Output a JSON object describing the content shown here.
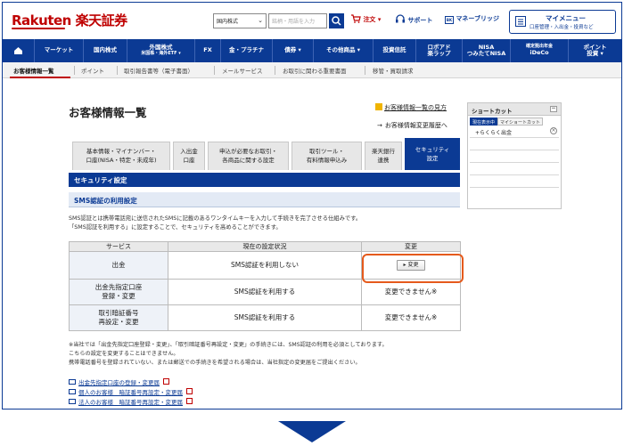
{
  "header": {
    "logo": "Rakuten 楽天証券",
    "select_value": "国内株式",
    "search_placeholder": "銘柄・用語を入力",
    "order_label": "注文",
    "support_label": "サポート",
    "money_bridge_label": "マネーブリッジ",
    "menu_label": "マイメニュー",
    "menu_sub": "口座管理・入出金・投資など"
  },
  "nav": {
    "items": [
      {
        "label": "マーケット"
      },
      {
        "label": "国内株式"
      },
      {
        "label": "外国株式",
        "sub": "米国株・海外ETF ▾"
      },
      {
        "label": "FX"
      },
      {
        "label": "金・プラチナ"
      },
      {
        "label": "債券 ▾"
      },
      {
        "label": "その他商品 ▾"
      },
      {
        "label": "投資信託"
      },
      {
        "label": "ロボアド",
        "sub": "楽ラップ"
      },
      {
        "label": "NISA",
        "sub": "つみたてNISA"
      },
      {
        "label": "確定拠出年金",
        "sub": "iDeCo"
      },
      {
        "label": "ポイント",
        "sub": "投資 ▾"
      }
    ]
  },
  "subnav": {
    "items": [
      "お客様情報一覧",
      "ポイント",
      "取引報告書等（電子書面）",
      "メールサービス",
      "お取引に関わる重要書面",
      "移管・買取請求"
    ]
  },
  "page": {
    "title": "お客様情報一覧",
    "guide_link": "お客様情報一覧の見方",
    "history_link": "お客様情報変更履歴へ"
  },
  "tabs": [
    "基本情報・マイナンバー・\n口座(NISA・特定・未成年)",
    "入出金\n口座",
    "申込が必要なお取引・\n各商品に関する設定",
    "取引ツール・\n有料情報申込み",
    "楽天銀行\n連携",
    "セキュリティ\n設定"
  ],
  "section": {
    "bar": "セキュリティ設定",
    "sub_bar": "SMS認証の利用設定",
    "desc_line1": "SMS認証とは携帯電話宛に送信されたSMSに記載のあるワンタイムキーを入力して手続きを完了させる仕組みです。",
    "desc_line2": "「SMS認証を利用する」に設定することで、セキュリティを高めることができます。"
  },
  "table": {
    "headers": [
      "サービス",
      "現在の設定状況",
      "変更"
    ],
    "rows": [
      {
        "service": "出金",
        "status": "SMS認証を利用しない",
        "change": "▸ 変更"
      },
      {
        "service": "出金先指定口座\n登録・変更",
        "status": "SMS認証を利用する",
        "change": "変更できません※"
      },
      {
        "service": "取引暗証番号\n再設定・変更",
        "status": "SMS認証を利用する",
        "change": "変更できません※"
      }
    ]
  },
  "notes": {
    "line1": "※当社では「出金先指定口座登録・変更」、「取引暗証番号再設定・変更」の手続きには、SMS認証の利用を必須としております。",
    "line2": "こちらの設定を変更することはできません。",
    "line3": "携帯電話番号を登録されていない、または郵送での手続きを希望される場合は、当社指定の変更届をご提出ください。"
  },
  "links": [
    "出金先指定口座の登録・変更届",
    "個人のお客様　暗証番号再設定・変更届",
    "法人のお客様　暗証番号再設定・変更届"
  ],
  "shortcut": {
    "title": "ショートカット",
    "min_label": "－",
    "tab_active": "現在表示中",
    "tab_other": "マイショートカット",
    "item": "+らくらく出金"
  },
  "colors": {
    "brand_red": "#bf0000",
    "nav_blue": "#0b3a94",
    "highlight": "#e55a1c"
  }
}
